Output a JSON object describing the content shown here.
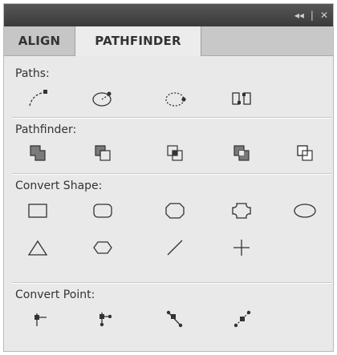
{
  "window": {
    "title_controls": [
      "◂◂",
      "|",
      "✕"
    ]
  },
  "tabs": [
    {
      "label": "ALIGN",
      "active": false
    },
    {
      "label": "PATHFINDER",
      "active": true
    }
  ],
  "sections": {
    "paths": {
      "label": "Paths:"
    },
    "pathfinder": {
      "label": "Pathfinder:"
    },
    "convert_shape": {
      "label": "Convert Shape:"
    },
    "convert_point": {
      "label": "Convert Point:"
    }
  },
  "icons": {
    "paths": [
      "open-path-icon",
      "closed-path-icon",
      "reverse-path-icon",
      "break-path-icon"
    ],
    "pathfinder": [
      "unite-icon",
      "minus-front-icon",
      "intersect-icon",
      "exclude-icon",
      "minus-back-icon"
    ],
    "convert_shape_row1": [
      "rectangle-icon",
      "rounded-rectangle-icon",
      "beveled-rectangle-icon",
      "inverse-rounded-rectangle-icon",
      "ellipse-icon"
    ],
    "convert_shape_row2": [
      "triangle-icon",
      "polygon-icon",
      "line-icon",
      "orthogonal-line-icon"
    ],
    "convert_point": [
      "plain-point-icon",
      "corner-point-icon",
      "smooth-point-icon",
      "symmetrical-point-icon"
    ]
  }
}
